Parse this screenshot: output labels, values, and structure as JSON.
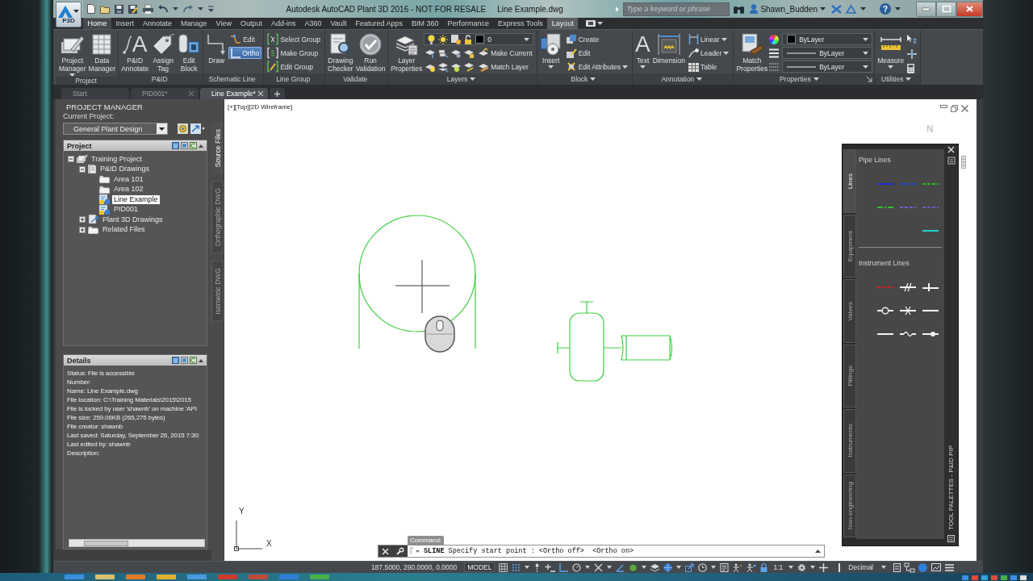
{
  "window": {
    "title": "Autodesk AutoCAD Plant 3D 2016 - NOT FOR RESALE",
    "file_name": "Line Example.dwg",
    "app_badge": "P3D"
  },
  "search": {
    "placeholder": "Type a keyword or phrase"
  },
  "user": {
    "name": "Shawn_Budden"
  },
  "help": {
    "glyph": "?"
  },
  "ribbon_tabs": [
    {
      "label": "Home",
      "selected": true,
      "hovered": false
    },
    {
      "label": "Insert",
      "selected": false,
      "hovered": false
    },
    {
      "label": "Annotate",
      "selected": false,
      "hovered": false
    },
    {
      "label": "Manage",
      "selected": false,
      "hovered": false
    },
    {
      "label": "View",
      "selected": false,
      "hovered": false
    },
    {
      "label": "Output",
      "selected": false,
      "hovered": false
    },
    {
      "label": "Add-ins",
      "selected": false,
      "hovered": false
    },
    {
      "label": "A360",
      "selected": false,
      "hovered": false
    },
    {
      "label": "Vault",
      "selected": false,
      "hovered": false
    },
    {
      "label": "Featured Apps",
      "selected": false,
      "hovered": false
    },
    {
      "label": "BIM 360",
      "selected": false,
      "hovered": false
    },
    {
      "label": "Performance",
      "selected": false,
      "hovered": false
    },
    {
      "label": "Express Tools",
      "selected": false,
      "hovered": false
    },
    {
      "label": "Layout",
      "selected": false,
      "hovered": true
    }
  ],
  "ribbon_panels": [
    {
      "title": "Project",
      "menu": false,
      "launcher": false,
      "items": [
        {
          "kind": "large",
          "label": "Project\nManager",
          "menu": true
        },
        {
          "kind": "large",
          "label": "Data\nManager",
          "menu": false
        }
      ]
    },
    {
      "title": "P&ID",
      "menu": false,
      "launcher": false,
      "items": [
        {
          "kind": "large",
          "label": "P&ID\nAnnotate",
          "glyph": "A",
          "menu": false
        },
        {
          "kind": "large",
          "label": "Assign\nTag",
          "menu": false
        },
        {
          "kind": "large",
          "label": "Edit\nBlock",
          "menu": false
        }
      ]
    },
    {
      "title": "Schematic Line",
      "menu": false,
      "launcher": false,
      "items": [
        {
          "kind": "large",
          "label": "Draw",
          "menu": false,
          "active": false
        },
        {
          "kind": "small",
          "label": "Edit",
          "menu": false,
          "active": false
        },
        {
          "kind": "small",
          "label": "Ortho",
          "menu": false,
          "active": true
        }
      ]
    },
    {
      "title": "Line Group",
      "menu": false,
      "launcher": false,
      "items": [
        {
          "kind": "small",
          "label": "Select Group",
          "menu": false
        },
        {
          "kind": "small",
          "label": "Make Group",
          "menu": false
        },
        {
          "kind": "small",
          "label": "Edit Group",
          "menu": false
        }
      ]
    },
    {
      "title": "Validate",
      "menu": false,
      "launcher": false,
      "items": [
        {
          "kind": "large",
          "label": "Drawing\nChecker",
          "menu": false
        },
        {
          "kind": "large",
          "label": "Run\nValidation",
          "menu": false
        }
      ]
    },
    {
      "title": "Layers",
      "menu": true,
      "launcher": false,
      "items": [
        {
          "kind": "large",
          "label": "Layer\nProperties",
          "menu": false
        },
        {
          "kind": "layer_combo",
          "value": "0"
        },
        {
          "kind": "tool_row",
          "label": "Make Current"
        },
        {
          "kind": "tool_row",
          "label": "Match Layer"
        }
      ]
    },
    {
      "title": "Block",
      "menu": true,
      "launcher": false,
      "items": [
        {
          "kind": "large",
          "label": "Insert",
          "menu": true
        },
        {
          "kind": "small",
          "label": "Create",
          "menu": false
        },
        {
          "kind": "small",
          "label": "Edit",
          "menu": false
        },
        {
          "kind": "small",
          "label": "Edit Attributes",
          "menu": true
        }
      ]
    },
    {
      "title": "Annotation",
      "menu": true,
      "launcher": false,
      "items": [
        {
          "kind": "large",
          "label": "Text",
          "glyph": "A",
          "menu": true
        },
        {
          "kind": "large",
          "label": "Dimension",
          "menu": false
        },
        {
          "kind": "small",
          "label": "Linear",
          "menu": true
        },
        {
          "kind": "small",
          "label": "Leader",
          "menu": true
        },
        {
          "kind": "small",
          "label": "Table",
          "menu": false
        }
      ]
    },
    {
      "title": "Properties",
      "menu": true,
      "launcher": true,
      "items": [
        {
          "kind": "large",
          "label": "Match\nProperties",
          "menu": false
        },
        {
          "kind": "color_combo",
          "value": "ByLayer"
        },
        {
          "kind": "linetype_combo",
          "value": "ByLayer"
        },
        {
          "kind": "lineweight_combo",
          "value": "ByLayer"
        }
      ]
    },
    {
      "title": "Utilities",
      "menu": true,
      "launcher": false,
      "items": [
        {
          "kind": "large",
          "label": "Measure",
          "menu": true
        },
        {
          "kind": "icon_stack"
        }
      ]
    }
  ],
  "document_tabs": [
    {
      "label": "Start",
      "selected": false,
      "closable": false
    },
    {
      "label": "PID001*",
      "selected": false,
      "closable": true
    },
    {
      "label": "Line Example*",
      "selected": true,
      "closable": true
    }
  ],
  "project_manager": {
    "title": "PROJECT MANAGER",
    "current_project_label": "Current Project:",
    "current_project": "General Plant Design",
    "tree_panel": {
      "title": "Project",
      "items": [
        {
          "label": "Training Project",
          "kind": "project",
          "expanded": true,
          "selected": false,
          "children": [
            {
              "label": "P&ID Drawings",
              "kind": "pid_folder",
              "expanded": true,
              "selected": false,
              "children": [
                {
                  "label": "Area 101",
                  "kind": "folder",
                  "selected": false
                },
                {
                  "label": "Area 102",
                  "kind": "folder",
                  "selected": false
                },
                {
                  "label": "Line Example",
                  "kind": "drawing",
                  "selected": true
                },
                {
                  "label": "PID001",
                  "kind": "drawing",
                  "selected": false
                }
              ]
            },
            {
              "label": "Plant 3D Drawings",
              "kind": "plant_folder",
              "expanded": false,
              "selected": false
            },
            {
              "label": "Related Files",
              "kind": "related_folder",
              "expanded": false,
              "selected": false
            }
          ]
        }
      ]
    },
    "side_tabs": [
      {
        "label": "Source Files",
        "selected": true
      },
      {
        "label": "Orthographic DWG",
        "selected": false
      },
      {
        "label": "Isometric DWG",
        "selected": false
      }
    ],
    "details": {
      "title": "Details",
      "lines": [
        "Status: File is accessible",
        "Number:",
        "Name: Line Example.dwg",
        "File location: C:\\Training Materials\\2015\\2015",
        "File is locked by user 'shawnb' on machine 'API",
        "File size: 259.06KB (265,275 bytes)",
        "File creator: shawnb",
        "Last saved: Saturday, September 26, 2015 7:30:",
        "Last edited by: shawnb",
        "Description:"
      ]
    }
  },
  "viewport": {
    "label": "[+][Top][2D Wireframe]",
    "compass": "N"
  },
  "ucs": {
    "x_label": "X",
    "y_label": "Y"
  },
  "tool_palette": {
    "title": "TOOL PALETTES - P&ID PIP",
    "tabs": [
      {
        "label": "Lines",
        "selected": true
      },
      {
        "label": "Equipment",
        "selected": false
      },
      {
        "label": "Valves",
        "selected": false
      },
      {
        "label": "Fittings",
        "selected": false
      },
      {
        "label": "Instruments",
        "selected": false
      },
      {
        "label": "Non-engineering",
        "selected": false
      }
    ],
    "sections": [
      {
        "title": "Pipe Lines",
        "tools": [
          {
            "kind": "solid",
            "color": "#1c2fd8"
          },
          {
            "kind": "dashdot",
            "color": "#2a49d0"
          },
          {
            "kind": "dashed",
            "color": "#1fbf1f"
          },
          {
            "kind": "dashdot",
            "color": "#2fbf2f"
          },
          {
            "kind": "dashed",
            "color": "#7a5ad0"
          },
          {
            "kind": "dashed",
            "color": "#6a5ab8"
          },
          {
            "kind": "solid",
            "color": "#1fd0d0"
          }
        ]
      },
      {
        "title": "Instrument Lines",
        "tools": [
          {
            "kind": "dashed",
            "color": "#d02020"
          },
          {
            "kind": "double_slash",
            "color": "#f2f2f2"
          },
          {
            "kind": "tick",
            "color": "#f2f2f2"
          },
          {
            "kind": "circle",
            "color": "#f2f2f2"
          },
          {
            "kind": "cross",
            "color": "#f2f2f2"
          },
          {
            "kind": "solid",
            "color": "#f2f2f2"
          },
          {
            "kind": "solid",
            "color": "#f2f2f2"
          },
          {
            "kind": "wave",
            "color": "#f2f2f2"
          },
          {
            "kind": "dot",
            "color": "#f2f2f2"
          }
        ]
      }
    ]
  },
  "command_line": {
    "label": "Command:",
    "history": "**SLINE** Specify start point : <Ortho off>  <Ortho on>"
  },
  "status_bar": {
    "coordinates": "187.5000, 290.0000, 0.0000",
    "space": "MODEL",
    "scale": "1:1",
    "units": "Decimal"
  }
}
